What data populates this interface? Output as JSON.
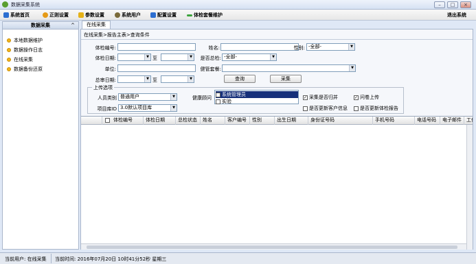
{
  "window": {
    "title": "数据采集系统",
    "min": "–",
    "max": "□",
    "close": "×"
  },
  "menu": {
    "items": [
      {
        "label": "系统首页",
        "color": "#2d6fd1"
      },
      {
        "label": "正则设置",
        "color": "#e59a17"
      },
      {
        "label": "参数设置",
        "color": "#e5b117"
      },
      {
        "label": "系统用户",
        "color": "#7a6a3a"
      },
      {
        "label": "配置设置",
        "color": "#2d6fd1"
      },
      {
        "label": "体检套餐维护",
        "color": "#3aa33a"
      }
    ],
    "exit": "退出系统"
  },
  "sidebar": {
    "title": "数据采集",
    "collapse": "^",
    "items": [
      "本地数据维护",
      "数据操作日志",
      "在线采集",
      "数据备份还原"
    ]
  },
  "tab": "在线采集",
  "breadcrumb": "在线采集>报告主表>查询条件",
  "form": {
    "exam_no": "体检编号:",
    "name": "姓名:",
    "gender": "性别:",
    "gender_value": "-全部-",
    "exam_date": "体检日期:",
    "to": "至",
    "is_summary": "是否总检:",
    "summary_value": "-全部-",
    "unit": "单位:",
    "package": "健管套餐:",
    "summary_date": "总审日期:",
    "query_btn": "查询",
    "collect_btn": "采集"
  },
  "upload": {
    "title": "上传选项",
    "person_type": "人员类别",
    "person_value": "普通用户",
    "project_lib": "项目库ID",
    "project_value": "3.0默认项目库",
    "advisor": "健康顾问",
    "advisor_options": [
      "系统管理员",
      "实验"
    ],
    "cb1": "采集是否归并",
    "cb1_checked": true,
    "cb2": "问卷上传",
    "cb2_checked": true,
    "cb3": "是否更新客户信息",
    "cb3_checked": false,
    "cb4": "是否更新体检报告",
    "cb4_checked": false
  },
  "grid": {
    "columns": [
      "体检编号",
      "体检日期",
      "总检状态",
      "姓名",
      "客户编号",
      "性别",
      "出生日期",
      "身份证号码",
      "手机号码",
      "电话号码",
      "电子邮件",
      "工作"
    ]
  },
  "status": {
    "user": "当前用户: 在线采集",
    "time": "当前时间: 2016年07月20日 10时41分52秒 星期三"
  }
}
